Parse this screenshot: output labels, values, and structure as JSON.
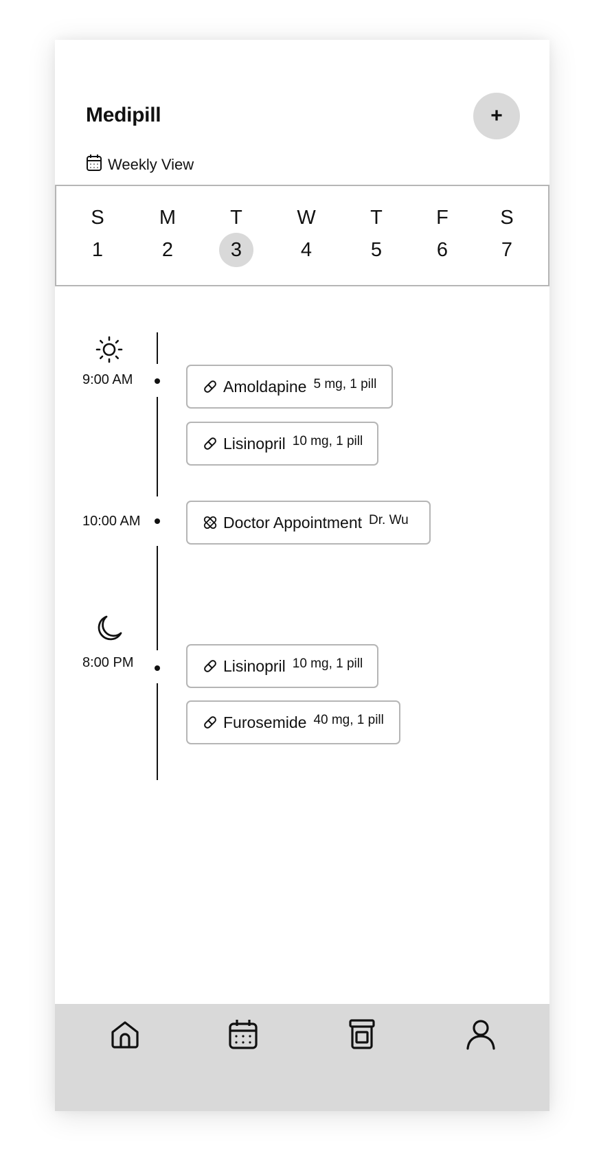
{
  "header": {
    "title": "Medipill",
    "add_label": "+",
    "view_label": "Weekly View"
  },
  "week": {
    "days": [
      {
        "letter": "S",
        "num": "1"
      },
      {
        "letter": "M",
        "num": "2"
      },
      {
        "letter": "T",
        "num": "3"
      },
      {
        "letter": "W",
        "num": "4"
      },
      {
        "letter": "T",
        "num": "5"
      },
      {
        "letter": "F",
        "num": "6"
      },
      {
        "letter": "S",
        "num": "7"
      }
    ],
    "selected_index": 2
  },
  "schedule": {
    "morning": {
      "icon": "sun-icon",
      "time": "9:00 AM",
      "events": [
        {
          "name": "Amoldapine",
          "detail": "5 mg, 1 pill",
          "icon": "pill-icon"
        },
        {
          "name": "Lisinopril",
          "detail": "10 mg, 1 pill",
          "icon": "pill-icon"
        }
      ]
    },
    "mid_morning": {
      "time": "10:00 AM",
      "events": [
        {
          "name": "Doctor Appointment",
          "detail": "Dr. Wu",
          "icon": "bandage-icon"
        }
      ]
    },
    "evening": {
      "icon": "moon-icon",
      "time": "8:00 PM",
      "events": [
        {
          "name": "Lisinopril",
          "detail": "10 mg, 1 pill",
          "icon": "pill-icon"
        },
        {
          "name": "Furosemide",
          "detail": "40 mg, 1 pill",
          "icon": "pill-icon"
        }
      ]
    }
  },
  "nav": {
    "items": [
      "home-icon",
      "calendar-icon",
      "pill-bottle-icon",
      "profile-icon"
    ]
  },
  "colors": {
    "accent_gray": "#d9d9d9",
    "border_gray": "#b5b5b5",
    "text": "#111111"
  }
}
